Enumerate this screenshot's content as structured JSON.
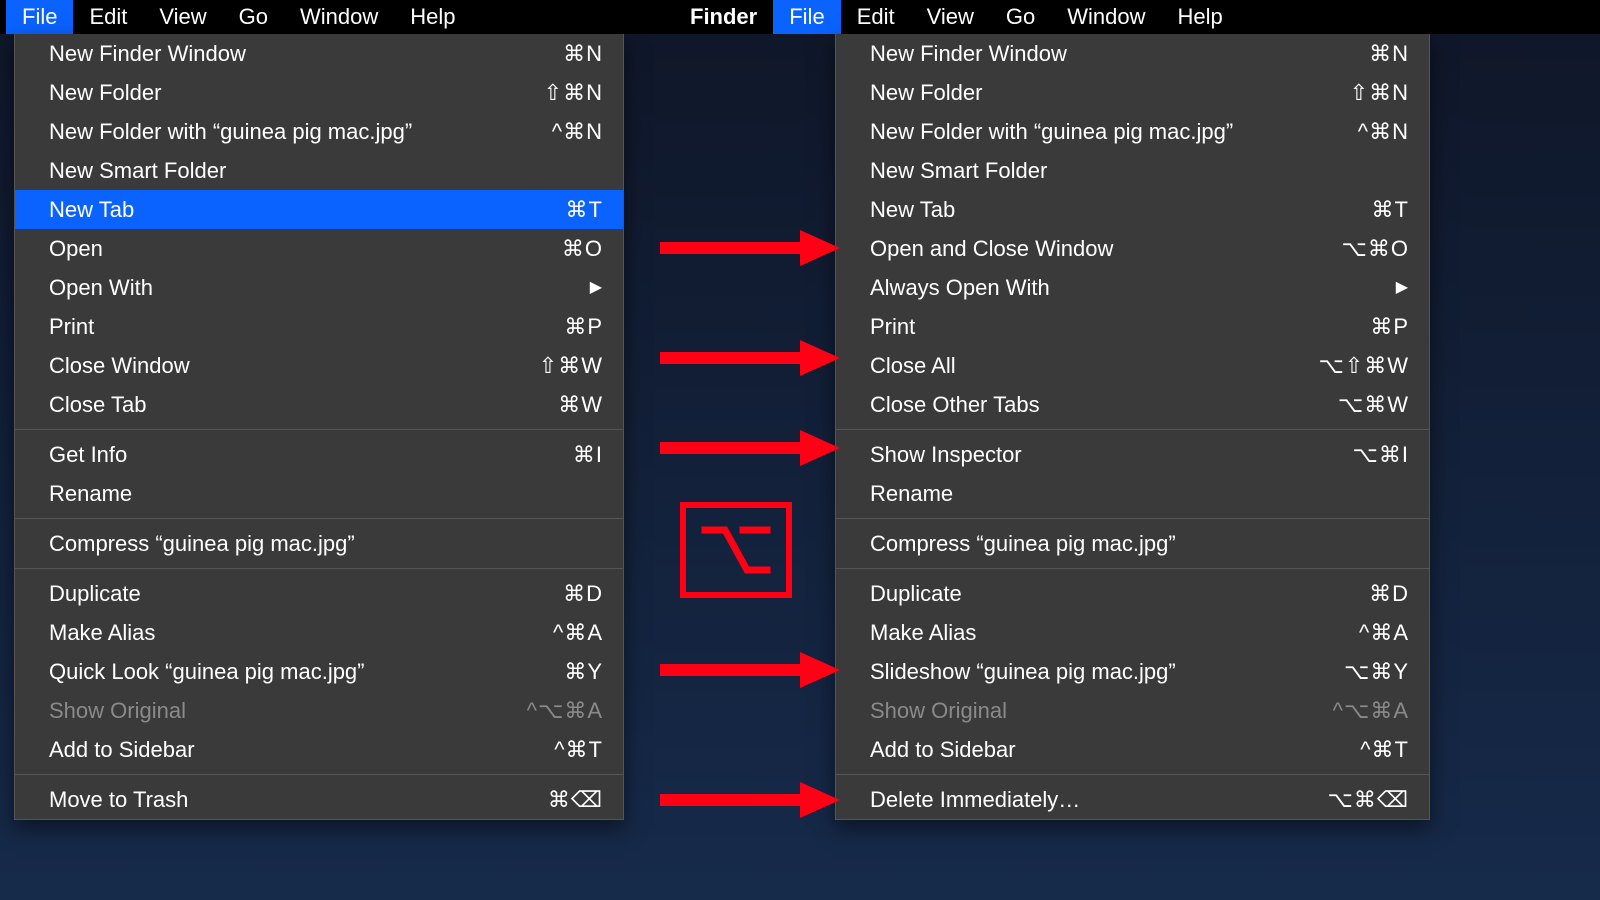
{
  "menubar_left": {
    "items": [
      "File",
      "Edit",
      "View",
      "Go",
      "Window",
      "Help"
    ],
    "selected_index": 0
  },
  "menubar_right": {
    "app": "Finder",
    "items": [
      "File",
      "Edit",
      "View",
      "Go",
      "Window",
      "Help"
    ],
    "selected_index": 0
  },
  "left_menu": {
    "highlight_index": 4,
    "groups": [
      [
        {
          "label": "New Finder Window",
          "shortcut": "⌘N"
        },
        {
          "label": "New Folder",
          "shortcut": "⇧⌘N"
        },
        {
          "label": "New Folder with “guinea pig mac.jpg”",
          "shortcut": "^⌘N"
        },
        {
          "label": "New Smart Folder",
          "shortcut": ""
        },
        {
          "label": "New Tab",
          "shortcut": "⌘T"
        },
        {
          "label": "Open",
          "shortcut": "⌘O"
        },
        {
          "label": "Open With",
          "shortcut": "",
          "submenu": true
        },
        {
          "label": "Print",
          "shortcut": "⌘P"
        },
        {
          "label": "Close Window",
          "shortcut": "⇧⌘W"
        },
        {
          "label": "Close Tab",
          "shortcut": "⌘W"
        }
      ],
      [
        {
          "label": "Get Info",
          "shortcut": "⌘I"
        },
        {
          "label": "Rename",
          "shortcut": ""
        }
      ],
      [
        {
          "label": "Compress “guinea pig mac.jpg”",
          "shortcut": ""
        }
      ],
      [
        {
          "label": "Duplicate",
          "shortcut": "⌘D"
        },
        {
          "label": "Make Alias",
          "shortcut": "^⌘A"
        },
        {
          "label": "Quick Look “guinea pig mac.jpg”",
          "shortcut": "⌘Y"
        },
        {
          "label": "Show Original",
          "shortcut": "^⌥⌘A",
          "disabled": true
        },
        {
          "label": "Add to Sidebar",
          "shortcut": "^⌘T"
        }
      ],
      [
        {
          "label": "Move to Trash",
          "shortcut": "⌘⌫"
        }
      ]
    ]
  },
  "right_menu": {
    "groups": [
      [
        {
          "label": "New Finder Window",
          "shortcut": "⌘N"
        },
        {
          "label": "New Folder",
          "shortcut": "⇧⌘N"
        },
        {
          "label": "New Folder with “guinea pig mac.jpg”",
          "shortcut": "^⌘N"
        },
        {
          "label": "New Smart Folder",
          "shortcut": ""
        },
        {
          "label": "New Tab",
          "shortcut": "⌘T"
        },
        {
          "label": "Open and Close Window",
          "shortcut": "⌥⌘O"
        },
        {
          "label": "Always Open With",
          "shortcut": "",
          "submenu": true
        },
        {
          "label": "Print",
          "shortcut": "⌘P"
        },
        {
          "label": "Close All",
          "shortcut": "⌥⇧⌘W"
        },
        {
          "label": "Close Other Tabs",
          "shortcut": "⌥⌘W"
        }
      ],
      [
        {
          "label": "Show Inspector",
          "shortcut": "⌥⌘I"
        },
        {
          "label": "Rename",
          "shortcut": ""
        }
      ],
      [
        {
          "label": "Compress “guinea pig mac.jpg”",
          "shortcut": ""
        }
      ],
      [
        {
          "label": "Duplicate",
          "shortcut": "⌘D"
        },
        {
          "label": "Make Alias",
          "shortcut": "^⌘A"
        },
        {
          "label": "Slideshow “guinea pig mac.jpg”",
          "shortcut": "⌥⌘Y"
        },
        {
          "label": "Show Original",
          "shortcut": "^⌥⌘A",
          "disabled": true
        },
        {
          "label": "Add to Sidebar",
          "shortcut": "^⌘T"
        }
      ],
      [
        {
          "label": "Delete Immediately…",
          "shortcut": "⌥⌘⌫"
        }
      ]
    ]
  },
  "annotation": {
    "arrow_color": "#ff0015",
    "option_glyph": "⌥"
  }
}
